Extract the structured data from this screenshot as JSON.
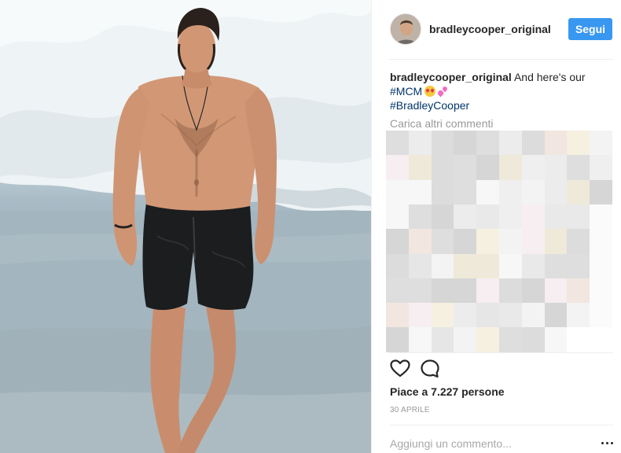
{
  "post": {
    "username": "bradleycooper_original",
    "follow_label": "Segui",
    "caption": {
      "username": "bradleycooper_original",
      "text": "And here's our",
      "hashtags": [
        "#MCM",
        "#BradleyCooper"
      ],
      "emoji": [
        "smiling-face-with-heart-eyes",
        "two-hearts"
      ]
    },
    "load_more_comments": "Carica altri commenti",
    "likes": "Piace a 7.227 persone",
    "date": "30 APRILE",
    "add_comment_placeholder": "Aggiungi un commento...",
    "icons": [
      "heart-icon",
      "comment-icon",
      "more-options-icon"
    ]
  },
  "colors": {
    "follow_button": "#3897f0",
    "hashtag": "#003569",
    "muted_text": "#999999",
    "divider": "#efefef"
  }
}
